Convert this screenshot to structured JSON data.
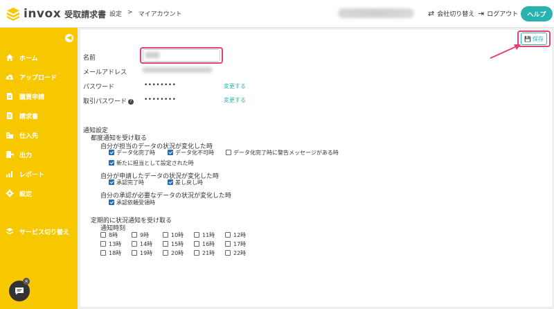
{
  "header": {
    "app_name": "invox",
    "app_sub": "受取請求書",
    "breadcrumb": [
      "設定",
      "マイアカウント"
    ],
    "company_switch": "会社切り替え",
    "logout": "ログアウト",
    "help": "ヘルプ"
  },
  "sidebar": {
    "items": [
      {
        "label": "ホーム",
        "icon": "home-icon"
      },
      {
        "label": "アップロード",
        "icon": "upload-icon"
      },
      {
        "label": "購買申請",
        "icon": "document-icon"
      },
      {
        "label": "請求書",
        "icon": "invoice-icon"
      },
      {
        "label": "仕入先",
        "icon": "building-icon"
      },
      {
        "label": "出力",
        "icon": "export-icon"
      },
      {
        "label": "レポート",
        "icon": "chart-icon"
      },
      {
        "label": "設定",
        "icon": "gear-icon"
      },
      {
        "label": "サービス切り替え",
        "icon": "switch-icon"
      }
    ]
  },
  "form": {
    "save": "保存",
    "name_label": "名前",
    "email_label": "メールアドレス",
    "password_label": "パスワード",
    "password_value": "••••••••",
    "trade_password_label": "取引パスワード",
    "trade_password_value": "••••••••",
    "change_link": "変更する",
    "change_link2": "変更する"
  },
  "notifications": {
    "title": "通知設定",
    "each_title": "都度通知を受け取る",
    "group1": {
      "title": "自分が担当のデータの状況が変化した時",
      "options": [
        {
          "label": "データ化完了時",
          "checked": true
        },
        {
          "label": "データ化不可時",
          "checked": true
        },
        {
          "label": "データ化完了時に警告メッセージがある時",
          "checked": false
        },
        {
          "label": "新たに担当として設定された時",
          "checked": true
        }
      ]
    },
    "group2": {
      "title": "自分が申請したデータの状況が変化した時",
      "options": [
        {
          "label": "承認完了時",
          "checked": true
        },
        {
          "label": "差し戻し時",
          "checked": true
        }
      ]
    },
    "group3": {
      "title": "自分の承認が必要なデータの状況が変化した時",
      "options": [
        {
          "label": "承認依頼受領時",
          "checked": true
        }
      ]
    },
    "periodic_title": "定期的に状況通知を受け取る",
    "time_title": "通知時刻",
    "hours": [
      "8時",
      "9時",
      "10時",
      "11時",
      "12時",
      "13時",
      "14時",
      "15時",
      "16時",
      "17時",
      "18時",
      "19時",
      "20時",
      "21時",
      "22時"
    ]
  },
  "colors": {
    "sidebar": "#f7c700",
    "accent": "#29b3b0",
    "highlight": "#e83f72"
  }
}
